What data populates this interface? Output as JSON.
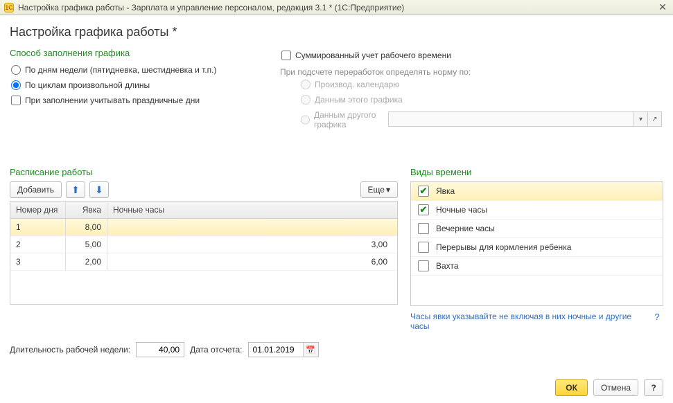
{
  "titlebar": {
    "logo_text": "1С",
    "title": "Настройка графика работы - Зарплата и управление персоналом, редакция 3.1 * (1С:Предприятие)"
  },
  "page_title": "Настройка графика работы *",
  "fill_method": {
    "title": "Способ заполнения графика",
    "by_days_label": "По дням недели (пятидневка, шестидневка и т.п.)",
    "by_cycles_label": "По циклам произвольной длины",
    "holidays_label": "При заполнении учитывать праздничные дни"
  },
  "summarized": {
    "label": "Суммированный учет рабочего времени",
    "hint": "При подсчете переработок определять норму по:",
    "opt_calendar": "Производ. календарю",
    "opt_this": "Данным этого графика",
    "opt_other": "Данным другого графика"
  },
  "schedule": {
    "title": "Расписание работы",
    "add_label": "Добавить",
    "more_label": "Еще",
    "headers": {
      "num": "Номер дня",
      "yavka": "Явка",
      "night": "Ночные часы"
    },
    "rows": [
      {
        "num": "1",
        "yavka": "8,00",
        "night": ""
      },
      {
        "num": "2",
        "yavka": "5,00",
        "night": "3,00"
      },
      {
        "num": "3",
        "yavka": "2,00",
        "night": "6,00"
      }
    ]
  },
  "types": {
    "title": "Виды времени",
    "items": [
      {
        "label": "Явка",
        "checked": true,
        "selected": true
      },
      {
        "label": "Ночные часы",
        "checked": true,
        "selected": false
      },
      {
        "label": "Вечерние часы",
        "checked": false,
        "selected": false
      },
      {
        "label": "Перерывы для кормления ребенка",
        "checked": false,
        "selected": false
      },
      {
        "label": "Вахта",
        "checked": false,
        "selected": false
      }
    ],
    "hint": "Часы явки указывайте не включая в них ночные и другие часы"
  },
  "bottom": {
    "week_len_label": "Длительность рабочей недели:",
    "week_len_value": "40,00",
    "date_label": "Дата отсчета:",
    "date_value": "01.01.2019"
  },
  "footer": {
    "ok": "ОК",
    "cancel": "Отмена",
    "help": "?"
  }
}
